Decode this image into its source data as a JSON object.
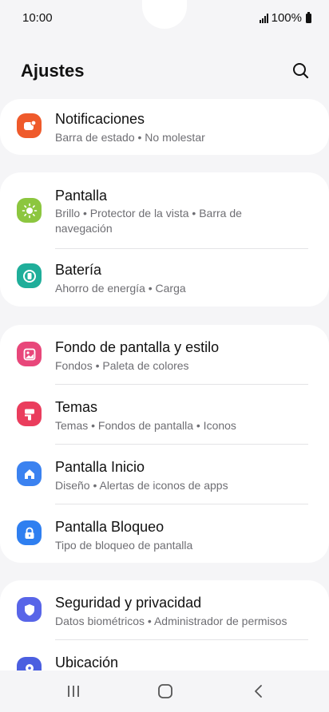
{
  "status_bar": {
    "time": "10:00",
    "battery_text": "100%"
  },
  "header": {
    "title": "Ajustes"
  },
  "colors": {
    "notificaciones": "#ef5a2b",
    "pantalla": "#8cc63f",
    "bateria": "#1fae9a",
    "fondo": "#e8477a",
    "temas": "#ea3d5d",
    "inicio": "#3b82f0",
    "bloqueo": "#2f7ff0",
    "seguridad": "#5865e8",
    "ubicacion": "#4b5fe0"
  },
  "items": {
    "notificaciones": {
      "title": "Notificaciones",
      "subtitle": "Barra de estado  •  No molestar",
      "icon": "notification-icon"
    },
    "pantalla": {
      "title": "Pantalla",
      "subtitle": "Brillo  •  Protector de la vista  •  Barra de navegación",
      "icon": "sun-icon"
    },
    "bateria": {
      "title": "Batería",
      "subtitle": "Ahorro de energía  •  Carga",
      "icon": "battery-icon"
    },
    "fondo": {
      "title": "Fondo de pantalla y estilo",
      "subtitle": "Fondos  •  Paleta de colores",
      "icon": "wallpaper-icon"
    },
    "temas": {
      "title": "Temas",
      "subtitle": "Temas  •  Fondos de pantalla  •  Iconos",
      "icon": "brush-icon"
    },
    "inicio": {
      "title": "Pantalla Inicio",
      "subtitle": "Diseño  •  Alertas de iconos de apps",
      "icon": "home-icon"
    },
    "bloqueo": {
      "title": "Pantalla Bloqueo",
      "subtitle": "Tipo de bloqueo de pantalla",
      "icon": "lock-icon"
    },
    "seguridad": {
      "title": "Seguridad y privacidad",
      "subtitle": "Datos biométricos  •  Administrador de permisos",
      "icon": "shield-icon"
    },
    "ubicacion": {
      "title": "Ubicación",
      "subtitle": "",
      "icon": "location-icon"
    }
  },
  "navbar": {
    "recents": "recents-icon",
    "home": "home-button-icon",
    "back": "back-icon"
  }
}
